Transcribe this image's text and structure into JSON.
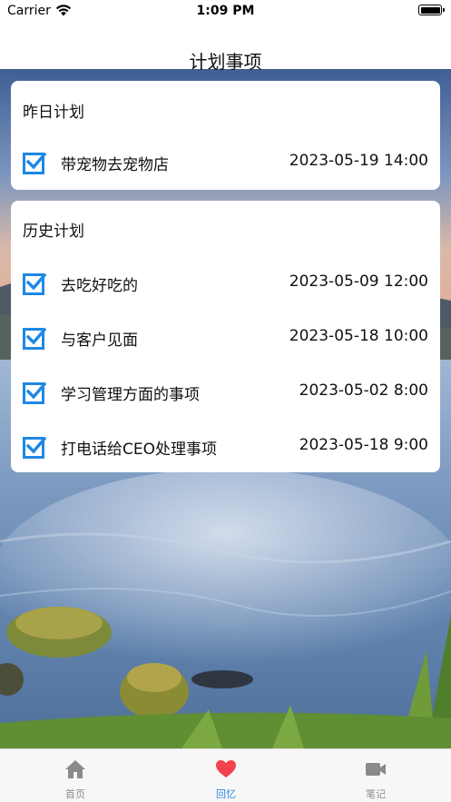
{
  "status_bar": {
    "carrier": "Carrier",
    "time": "1:09 PM"
  },
  "nav": {
    "title": "计划事项"
  },
  "yesterday": {
    "title": "昨日计划",
    "items": [
      {
        "label": "带宠物去宠物店",
        "time": "2023-05-19 14:00",
        "checked": true
      }
    ]
  },
  "history": {
    "title": "历史计划",
    "items": [
      {
        "label": "去吃好吃的",
        "time": "2023-05-09 12:00",
        "checked": true
      },
      {
        "label": "与客户见面",
        "time": "2023-05-18 10:00",
        "checked": true
      },
      {
        "label": "学习管理方面的事项",
        "time": "2023-05-02 8:00",
        "checked": true
      },
      {
        "label": "打电话给CEO处理事项",
        "time": "2023-05-18 9:00",
        "checked": true
      }
    ]
  },
  "tabs": [
    {
      "label": "首页",
      "icon": "home-icon",
      "active": false
    },
    {
      "label": "回忆",
      "icon": "heart-icon",
      "active": true
    },
    {
      "label": "笔记",
      "icon": "video-camera-icon",
      "active": false
    }
  ],
  "colors": {
    "accent": "#2f8ce0",
    "check": "#1e88e5",
    "heart": "#f2424e",
    "inactive": "#8a8a8a"
  }
}
